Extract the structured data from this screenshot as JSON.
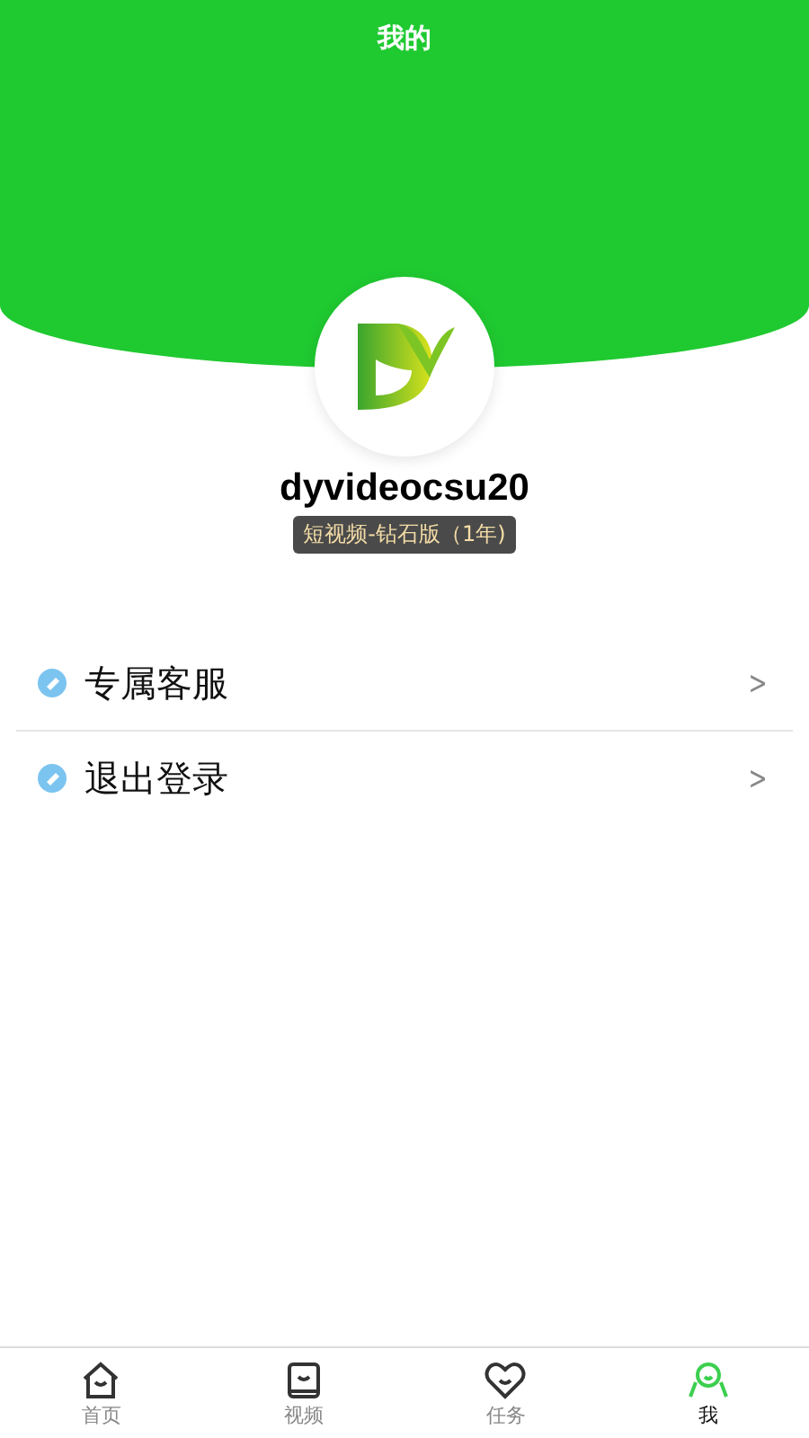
{
  "header": {
    "title": "我的"
  },
  "profile": {
    "username": "dyvideocsu20",
    "badge": "短视频-钻石版（1年)"
  },
  "menu": [
    {
      "label": "专属客服",
      "chevron": ">"
    },
    {
      "label": "退出登录",
      "chevron": ">"
    }
  ],
  "tabs": [
    {
      "kind": "home",
      "label": "首页",
      "selected": false
    },
    {
      "kind": "video",
      "label": "视频",
      "selected": false
    },
    {
      "kind": "task",
      "label": "任务",
      "selected": false
    },
    {
      "kind": "me",
      "label": "我",
      "selected": true
    }
  ]
}
